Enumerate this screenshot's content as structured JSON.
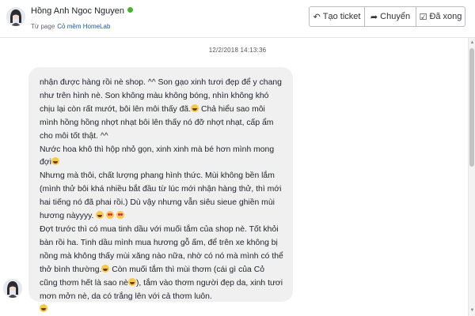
{
  "header": {
    "contact_name": "Hồng Anh Ngoc Nguyen",
    "from_page_prefix": "Từ page",
    "from_page_name": "Cỏ mềm HomeLab",
    "online_color": "#42b72a"
  },
  "actions": {
    "create_ticket": {
      "label": "Tạo ticket",
      "icon": "reply-icon"
    },
    "forward": {
      "label": "Chuyển",
      "icon": "forward-icon"
    },
    "done": {
      "label": "Đã xong",
      "icon": "checkbox-check-icon"
    }
  },
  "conversation": {
    "timestamp": "12/2/2018 14:13:36",
    "message": {
      "parts": [
        "nhận được hàng rồi nè shop. ^^ Son gạo xinh tươi đẹp để y chang như trên hình nè. Son không màu không bóng, nhìn không khó chịu lại còn rất mướt, bôi lên môi thấy đã.",
        " Chả hiểu sao môi mình hồng hồng nhợt nhạt bôi lên thấy nó đỡ nhợt nhạt, cấp ẩm cho môi tốt thật. ^^\nNước hoa khô thì hộp nhỏ gọn, xinh xinh mà bé hơn mình mong đợi",
        "\nNhưng mà thôi, chất lượng phang hình thức. Mùi không bền lắm (mình thử bôi khá nhiều bắt đầu từ lúc mới nhận hàng thử, thì mới hai tiếng nó đã phai rồi.) Dù vậy nhưng vẫn siêu sieue ghiền mùi hương nàyyyy.",
        "\nĐợt trước thì có mua tinh dầu với muối tắm của shop nè. Tốt khỏi bàn rồi ha. Tinh dầu mình mua hương gỗ ấm, để trên xe không bị nồng mà không thấy mùi xăng nào nữa, nhờ có nó mà mình có thể thở bình thường.",
        " Còn muối tắm thì mùi thơm (cái gì của Cỏ cũng thơm hết là sao nè",
        "), tắm vào thơm người đẹp da, xinh tươi mơn mởn nè, da có trắng lên với cả thơm luôn.",
        ""
      ]
    }
  },
  "colors": {
    "bubble_bg": "#f1f0f0",
    "page_link": "#1a56a6"
  }
}
